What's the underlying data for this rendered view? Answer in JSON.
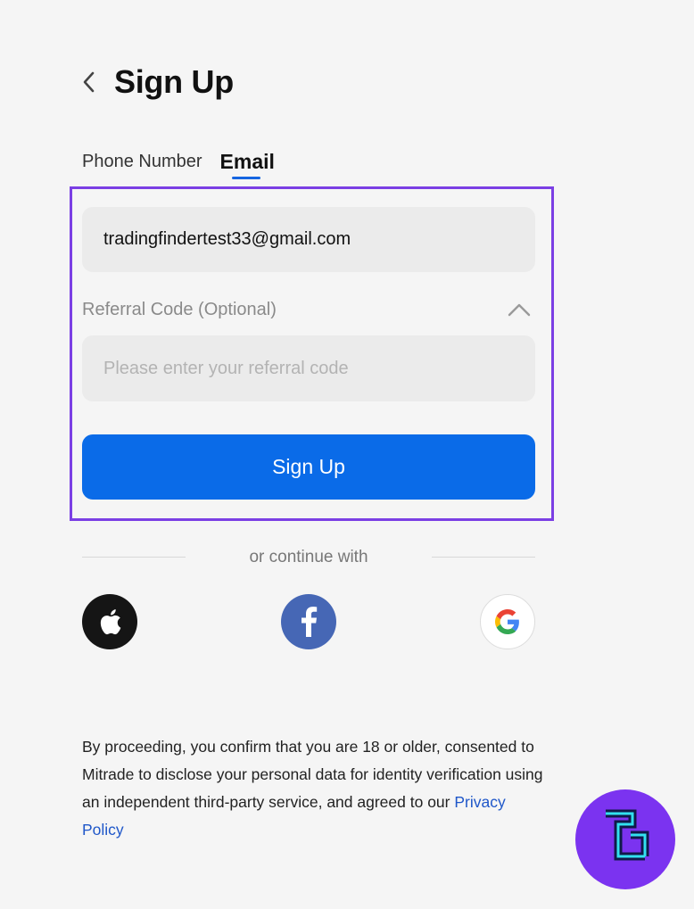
{
  "header": {
    "title": "Sign Up"
  },
  "tabs": [
    {
      "label": "Phone Number",
      "active": false
    },
    {
      "label": "Email",
      "active": true
    }
  ],
  "form": {
    "email_value": "tradingfindertest33@gmail.com",
    "referral_label": "Referral Code (Optional)",
    "referral_placeholder": "Please enter your referral code",
    "referral_value": "",
    "submit_label": "Sign Up"
  },
  "social": {
    "divider_text": "or continue with",
    "providers": [
      {
        "icon": "apple-icon",
        "color": "#151515"
      },
      {
        "icon": "facebook-icon",
        "color": "#4667b5"
      },
      {
        "icon": "google-icon",
        "color": "#ffffff"
      }
    ]
  },
  "consent": {
    "text": "By proceeding, you confirm that you are 18 or older, consented to Mitrade to disclose your personal data for identity verification using an independent third-party service, and agreed to our ",
    "link_text": "Privacy Policy"
  },
  "colors": {
    "accent": "#0a6be8",
    "highlight_border": "#7b3fe4",
    "link": "#1f57c9",
    "watermark_bg": "#7b33f0"
  }
}
